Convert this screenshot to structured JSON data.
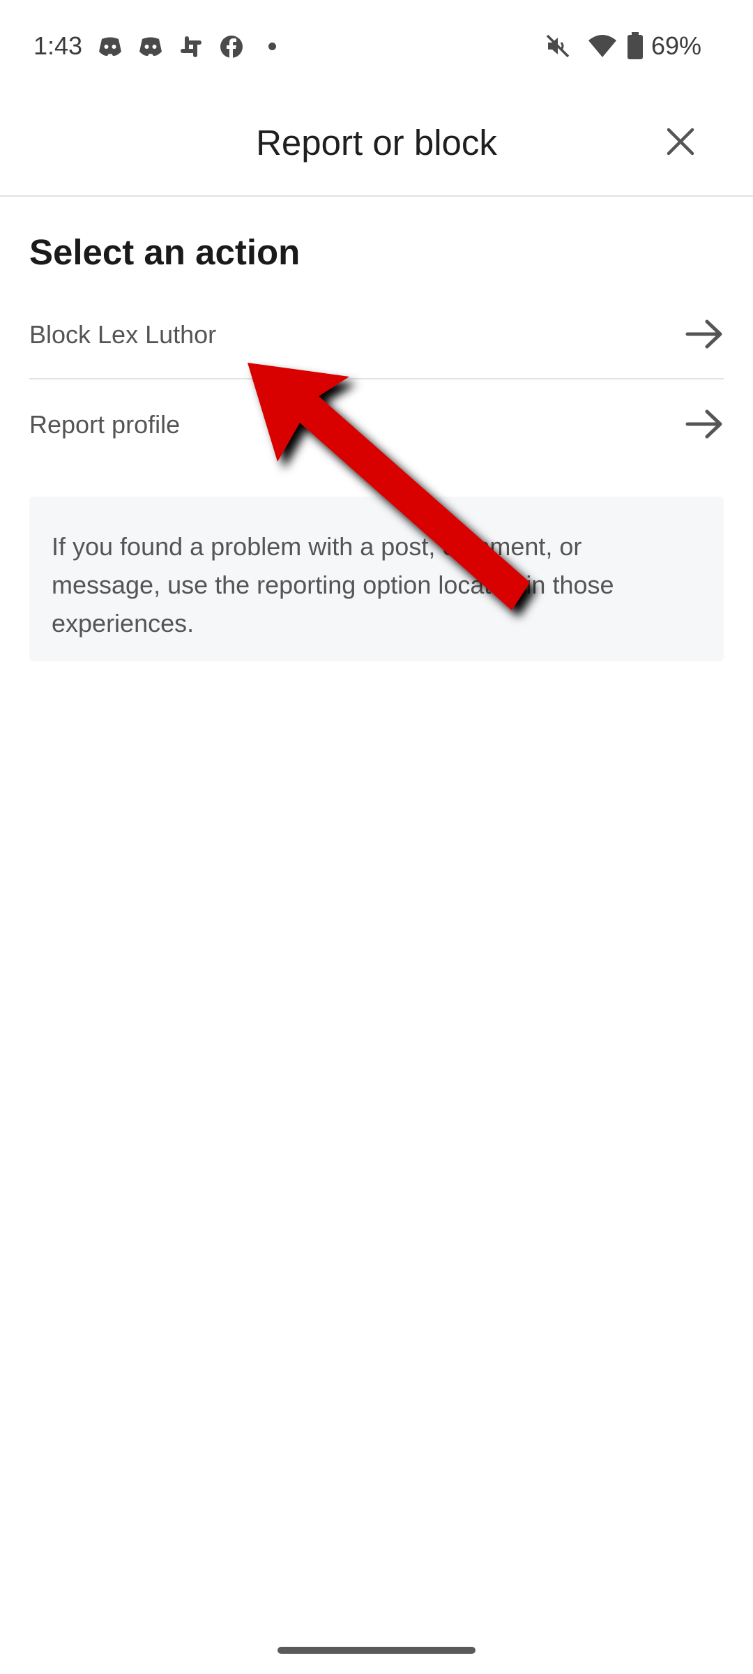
{
  "status_bar": {
    "time": "1:43",
    "battery_percent": "69%",
    "left_icons": [
      "discord-icon",
      "discord-icon",
      "slack-icon",
      "facebook-icon",
      "notification-dot"
    ],
    "right_icons": [
      "mute-icon",
      "wifi-icon",
      "battery-icon"
    ]
  },
  "header": {
    "title": "Report or block",
    "close_icon": "close-icon"
  },
  "main": {
    "section_title": "Select an action",
    "actions": [
      {
        "label": "Block Lex Luthor",
        "icon": "arrow-right-icon"
      },
      {
        "label": "Report profile",
        "icon": "arrow-right-icon"
      }
    ],
    "info_text": "If you found a problem with a post, comment, or message, use the reporting option located in those experiences."
  },
  "annotation": {
    "type": "arrow",
    "points_to": "Block Lex Luthor",
    "color": "#d90000"
  },
  "colors": {
    "background": "#ffffff",
    "divider": "#e3e3e3",
    "info_box_background": "#f6f7f9",
    "title_text": "#1f1f1f",
    "secondary_text": "#555555",
    "annotation_red": "#d90000"
  }
}
